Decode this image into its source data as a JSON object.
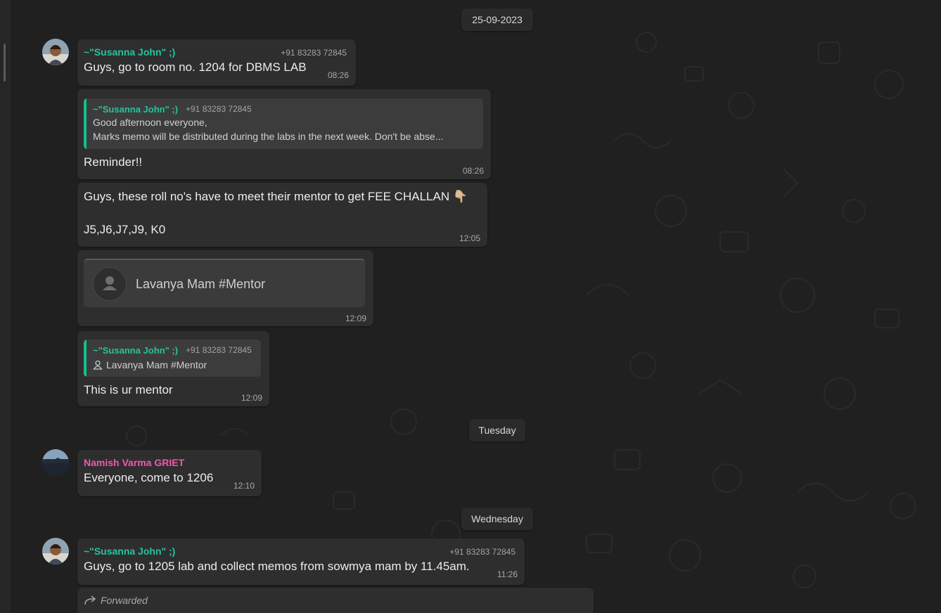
{
  "theme": {
    "accent_green": "#26c49c",
    "accent_pink": "#ee5ba8",
    "bubble_bg": "#2e2e2e",
    "chat_bg": "#202020"
  },
  "dates": {
    "d1": "25-09-2023",
    "d2": "Tuesday",
    "d3": "Wednesday"
  },
  "messages": {
    "m1": {
      "sender": "~\"Susanna John\" ;)",
      "phone": "+91 83283 72845",
      "text": "Guys, go to room no. 1204 for DBMS LAB",
      "time": "08:26"
    },
    "m2": {
      "quote_sender": "~\"Susanna John\" ;)",
      "quote_phone": "+91 83283 72845",
      "quote_line1": "Good afternoon everyone,",
      "quote_line2": "Marks memo will be distributed during the labs in the next week. Don't be abse...",
      "text": "Reminder!!",
      "time": "08:26"
    },
    "m3": {
      "line1": "Guys, these roll no's have to meet their mentor to get FEE CHALLAN 👇🏼",
      "line2": "J5,J6,J7,J9, K0",
      "time": "12:05"
    },
    "m4": {
      "contact_name": "Lavanya Mam #Mentor",
      "time": "12:09"
    },
    "m5": {
      "quote_sender": "~\"Susanna John\" ;)",
      "quote_phone": "+91 83283 72845",
      "quote_contact": "Lavanya Mam #Mentor",
      "text": "This is ur mentor",
      "time": "12:09"
    },
    "m6": {
      "sender": "Namish Varma GRIET",
      "text": "Everyone, come to 1206",
      "time": "12:10"
    },
    "m7": {
      "sender": "~\"Susanna John\" ;)",
      "phone": "+91 83283 72845",
      "text": "Guys, go to 1205 lab and collect memos from sowmya mam by 11.45am.",
      "time": "11:26"
    },
    "m8": {
      "forwarded_label": "Forwarded"
    }
  }
}
